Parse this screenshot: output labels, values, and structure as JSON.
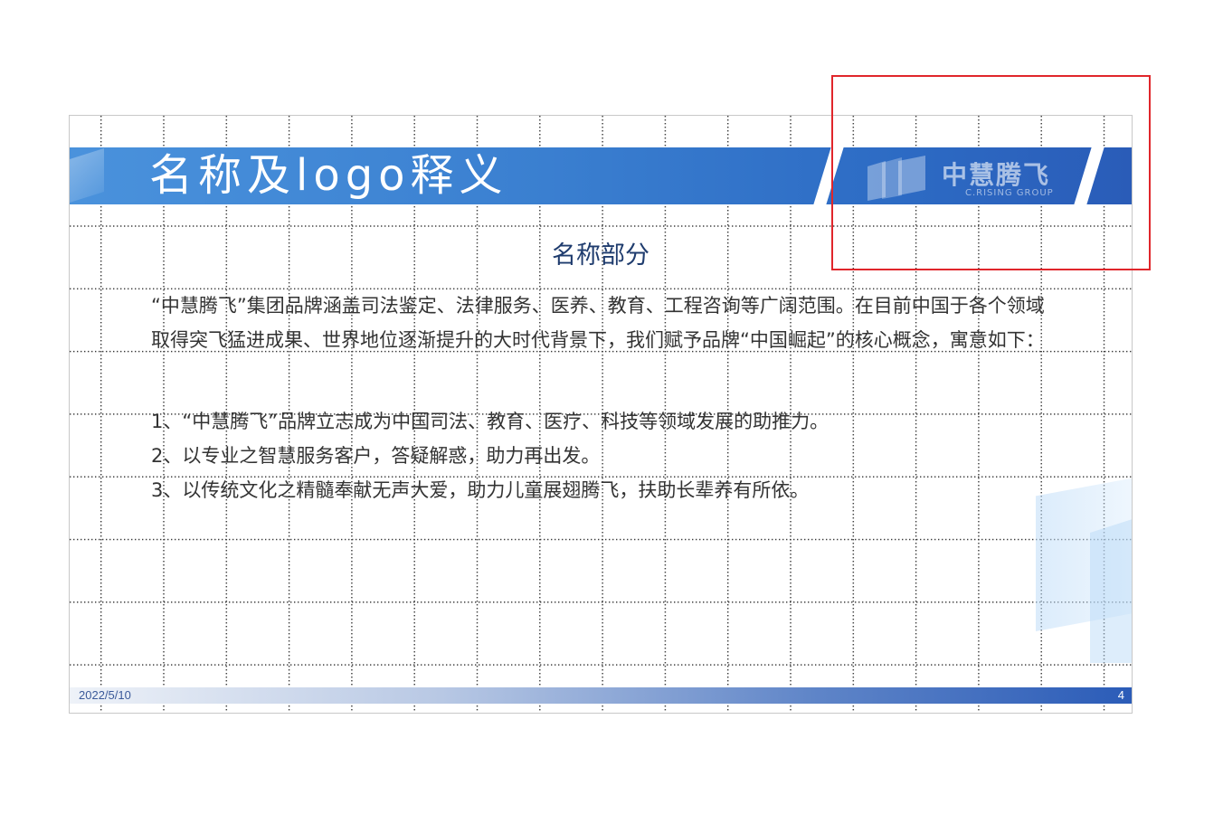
{
  "slide": {
    "title": "名称及logo释义",
    "logo": {
      "name": "中慧腾飞",
      "subtitle": "C.RISING GROUP"
    },
    "section_title": "名称部分",
    "intro": "“中慧腾飞”集团品牌涵盖司法鉴定、法律服务、医养、教育、工程咨询等广阔范围。在目前中国于各个领域取得突飞猛进成果、世界地位逐渐提升的大时代背景下，我们赋予品牌“中国崛起”的核心概念，寓意如下：",
    "points": [
      "1、“中慧腾飞”品牌立志成为中国司法、教育、医疗、科技等领域发展的助推力。",
      "2、以专业之智慧服务客户，答疑解惑，助力再出发。",
      "3、以传统文化之精髓奉献无声大爱，助力儿童展翅腾飞，扶助长辈养有所依。"
    ],
    "footer": {
      "date": "2022/5/10",
      "page_number": "4"
    }
  },
  "colors": {
    "title_band": "#3a7fd0",
    "section_title": "#1f3c6e",
    "highlight": "#e0262b"
  }
}
